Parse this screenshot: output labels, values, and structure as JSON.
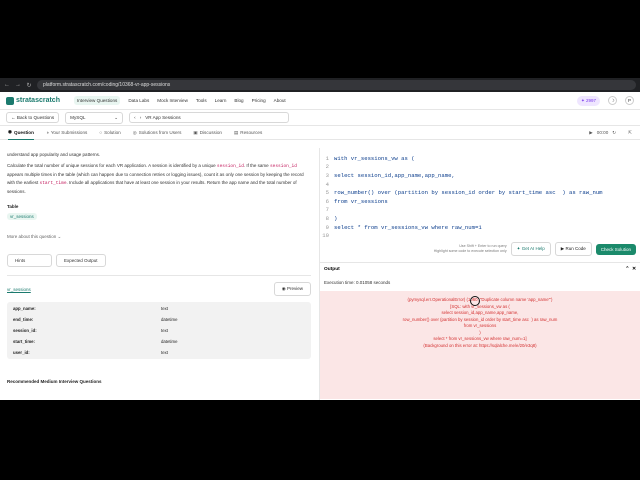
{
  "browser": {
    "url": "platform.stratascratch.com/coding/10368-vr-app-sessions"
  },
  "nav": {
    "logo": "stratascratch",
    "items": [
      "Interview Questions",
      "Data Labs",
      "Mock Interview",
      "Tools",
      "Learn",
      "Blog",
      "Pricing",
      "About"
    ],
    "points": "2997",
    "avatar": "P"
  },
  "toolbar": {
    "back": "Back to Questions",
    "language": "MySQL",
    "question_title": "VR App Sessions"
  },
  "tabs": [
    "Question",
    "Your Submissions",
    "Solution",
    "Solutions from Users",
    "Discussion",
    "Resources"
  ],
  "timer": "00:00",
  "question": {
    "intro": "understand app popularity and usage patterns.",
    "body_1": "Calculate the total number of unique sessions for each VR application. A session is identified by a unique",
    "code_1": "session_id",
    "body_2": ". If the same",
    "code_2": "session_id",
    "body_3": "appears multiple times in the table (which can happen due to connection retries or logging issues), count it as only one session by keeping the record with the earliest",
    "code_3": "start_time",
    "body_4": ". Include all applications that have at least one session in your results. Return the app name and the total number of sessions.",
    "table_heading": "Table",
    "table_tag": "vr_sessions",
    "more": "More about this question",
    "hints": "Hints",
    "expected": "Expected Output",
    "table_name": "vr_sessions",
    "preview": "Preview",
    "schema": [
      {
        "col": "app_name:",
        "type": "text"
      },
      {
        "col": "end_time:",
        "type": "datetime"
      },
      {
        "col": "session_id:",
        "type": "text"
      },
      {
        "col": "start_time:",
        "type": "datetime"
      },
      {
        "col": "user_id:",
        "type": "text"
      }
    ],
    "recommended": "Recommended Medium Interview Questions"
  },
  "editor": {
    "lines": [
      {
        "n": "1",
        "t": "with vr_sessions_vw as ("
      },
      {
        "n": "2",
        "t": ""
      },
      {
        "n": "3",
        "t": "select session_id,app_name,app_name,"
      },
      {
        "n": "4",
        "t": ""
      },
      {
        "n": "5",
        "t": "row_number() over (partition by session_id order by start_time asc  ) as raw_num"
      },
      {
        "n": "6",
        "t": "from vr_sessions"
      },
      {
        "n": "7",
        "t": ""
      },
      {
        "n": "8",
        "t": ")"
      },
      {
        "n": "9",
        "t": "select * from vr_sessions_vw where raw_num=1"
      },
      {
        "n": "10",
        "t": ""
      }
    ]
  },
  "run": {
    "hint_1": "Use Shift + Enter to run query",
    "hint_2": "Highlight some code to execute selection only",
    "ai": "Get AI Help",
    "run": "Run Code",
    "check": "Check Solution"
  },
  "output": {
    "title": "Output",
    "exec": "Execution time: 0.01058 seconds",
    "error": [
      "(pymysql.err.OperationalError) (1060, \"Duplicate column name 'app_name'\")",
      "[SQL: with vr_sessions_vw as (",
      "",
      "select session_id,app_name,app_name,",
      "",
      "row_number() over (partition by session_id order by start_time asc  ) as raw_num",
      "from vr_sessions",
      "",
      ")",
      "select * from vr_sessions_vw where raw_num=1]",
      "(Background on this error at: https://sqlalche.me/e/20/e3q8)"
    ]
  }
}
